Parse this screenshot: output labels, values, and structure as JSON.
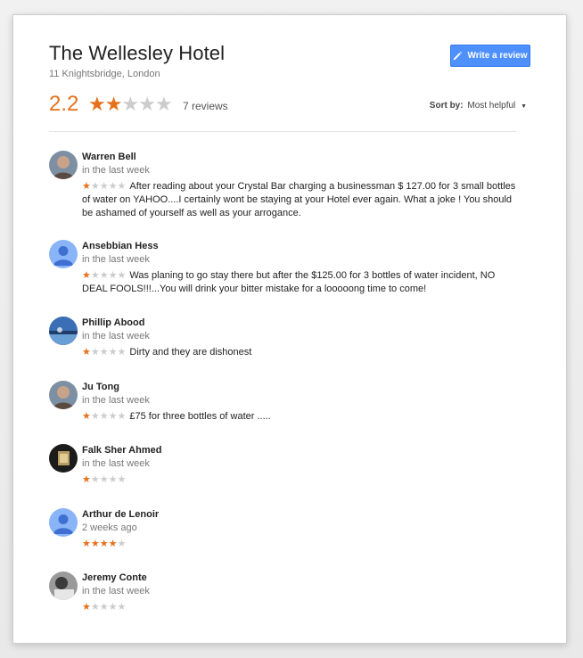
{
  "hotel": {
    "name": "The Wellesley Hotel",
    "address": "11 Knightsbridge, London",
    "rating": "2.2",
    "review_count": "7 reviews",
    "rating_stars": 2.2
  },
  "write_button": {
    "label": "Write a review",
    "icon": "pencil-icon"
  },
  "sort": {
    "label": "Sort by:",
    "value": "Most helpful",
    "icon": "chevron-down-icon"
  },
  "colors": {
    "accent": "#e7711b",
    "button": "#4d90fe",
    "star_off": "#cccccc"
  },
  "reviews": [
    {
      "name": "Warren Bell",
      "date": "in the last week",
      "stars": 1,
      "text": "After reading about your Crystal Bar charging a businessman $ 127.00 for 3 small bottles of water on YAHOO....I certainly wont be staying at your Hotel ever again. What a joke ! You should be ashamed of yourself as well as your arrogance.",
      "avatar": "photo-portrait"
    },
    {
      "name": "Ansebbian Hess",
      "date": "in the last week",
      "stars": 1,
      "text": "Was planing to go stay there but after the $125.00 for 3 bottles of water incident, NO DEAL FOOLS!!!...You will drink your bitter mistake for a looooong time to come!",
      "avatar": "default-person-icon"
    },
    {
      "name": "Phillip Abood",
      "date": "in the last week",
      "stars": 1,
      "text": "Dirty and they are dishonest",
      "avatar": "photo-landscape"
    },
    {
      "name": "Ju Tong",
      "date": "in the last week",
      "stars": 1,
      "text": "£75 for three bottles of water .....",
      "avatar": "photo-portrait"
    },
    {
      "name": "Falk Sher Ahmed",
      "date": "in the last week",
      "stars": 1,
      "text": "",
      "avatar": "photo-dark"
    },
    {
      "name": "Arthur de Lenoir",
      "date": "2 weeks ago",
      "stars": 4,
      "text": "",
      "avatar": "default-person-icon"
    },
    {
      "name": "Jeremy Conte",
      "date": "in the last week",
      "stars": 1,
      "text": "",
      "avatar": "photo-bw"
    }
  ]
}
